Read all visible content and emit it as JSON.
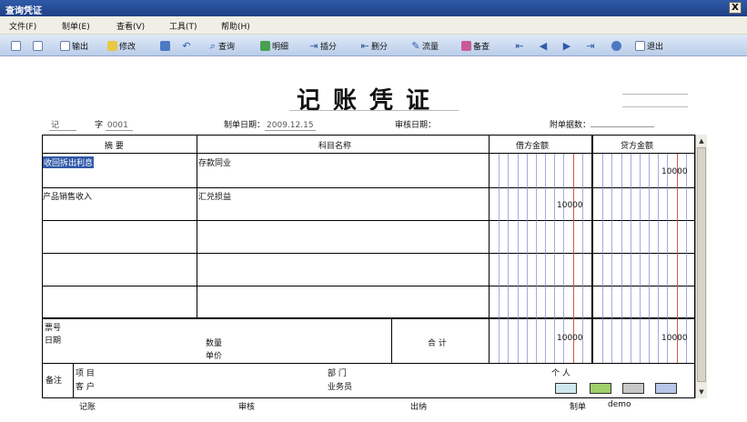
{
  "window": {
    "title": "查询凭证",
    "close": "X"
  },
  "menu": [
    "文件(F)",
    "制单(E)",
    "查看(V)",
    "工具(T)",
    "帮助(H)"
  ],
  "toolbar": {
    "output": "输出",
    "modify": "修改",
    "query": "查询",
    "detail": "明细",
    "insert": "插分",
    "delete": "删分",
    "flow": "流量",
    "memo": "备查",
    "exit": "退出"
  },
  "voucher": {
    "title": "记账凭证",
    "type": "记",
    "zi": "字",
    "number": "0001",
    "date_label": "制单日期：",
    "date": "2009.12.15",
    "audit_label": "审核日期：",
    "attach_label": "附单据数："
  },
  "table": {
    "headers": {
      "summary": "摘 要",
      "account": "科目名称",
      "debit": "借方金额",
      "credit": "贷方金额"
    },
    "rows": [
      {
        "summary": "收回拆出利息",
        "account": "存款同业",
        "debit": "",
        "credit": "10000"
      },
      {
        "summary": "产品销售收入",
        "account": "汇兑损益",
        "debit": "10000",
        "credit": ""
      },
      {
        "summary": "",
        "account": "",
        "debit": "",
        "credit": ""
      },
      {
        "summary": "",
        "account": "",
        "debit": "",
        "credit": ""
      },
      {
        "summary": "",
        "account": "",
        "debit": "",
        "credit": ""
      }
    ],
    "footer": {
      "bill_no": "票号",
      "date": "日期",
      "quantity": "数量",
      "unit_price": "单价",
      "total": "合 计",
      "total_debit": "10000",
      "total_credit": "10000"
    },
    "memo": {
      "label": "备注",
      "project": "项 目",
      "customer": "客 户",
      "dept": "部 门",
      "salesman": "业务员",
      "person": "个 人"
    }
  },
  "signatures": {
    "book": "记账",
    "audit": "审核",
    "cashier": "出纳",
    "maker": "制单",
    "maker_name": "demo"
  }
}
